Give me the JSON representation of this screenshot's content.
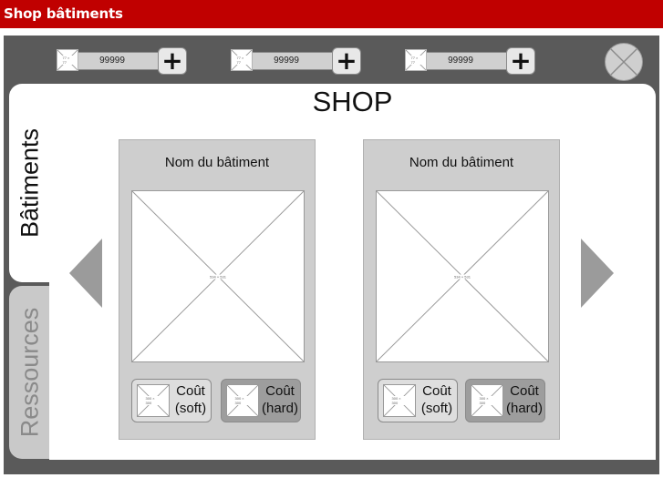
{
  "window": {
    "title": "Shop bâtiments"
  },
  "resources": [
    {
      "icon": "resource-placeholder-icon",
      "icon_text": "77 × 77",
      "value": "99999",
      "add_label": "+"
    },
    {
      "icon": "resource-placeholder-icon",
      "icon_text": "77 × 77",
      "value": "99999",
      "add_label": "+"
    },
    {
      "icon": "resource-placeholder-icon",
      "icon_text": "77 × 77",
      "value": "99999",
      "add_label": "+"
    }
  ],
  "close_icon": "close-icon",
  "tabs": [
    {
      "label": "Bâtiments",
      "active": true
    },
    {
      "label": "Ressources",
      "active": false
    }
  ],
  "shop": {
    "title": "SHOP"
  },
  "navigation": {
    "prev_icon": "triangle-left-icon",
    "next_icon": "triangle-right-icon"
  },
  "cards": [
    {
      "name": "Nom du bâtiment",
      "image_text": "534 × 531",
      "soft": {
        "icon_text": "300 × 300",
        "line1": "Coût",
        "line2": "(soft)"
      },
      "hard": {
        "icon_text": "300 × 300",
        "line1": "Coût",
        "line2": "(hard)"
      }
    },
    {
      "name": "Nom du bâtiment",
      "image_text": "534 × 531",
      "soft": {
        "icon_text": "300 × 300",
        "line1": "Coût",
        "line2": "(soft)"
      },
      "hard": {
        "icon_text": "300 × 300",
        "line1": "Coût",
        "line2": "(hard)"
      }
    }
  ],
  "colors": {
    "title_bar": "#c00000",
    "frame": "#5a5a5a",
    "card": "#cecece",
    "hard_button": "#9d9d9d",
    "arrow": "#9b9b9b"
  }
}
